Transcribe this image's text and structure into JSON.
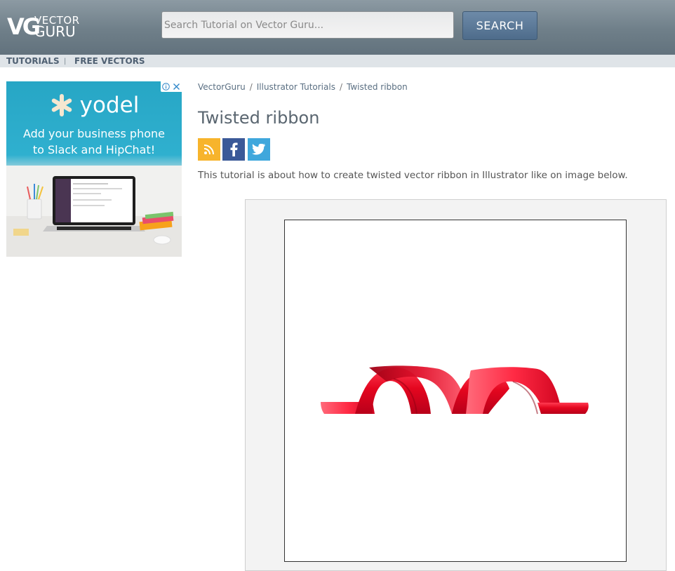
{
  "header": {
    "logo": {
      "mark": "VG",
      "top": "VECTOR",
      "bottom": "GURU"
    },
    "search": {
      "placeholder": "Search Tutorial on Vector Guru...",
      "button_label": "SEARCH"
    }
  },
  "nav": {
    "items": [
      {
        "label": "TUTORIALS"
      },
      {
        "label": "FREE VECTORS"
      }
    ],
    "separator": "|"
  },
  "ad": {
    "brand": "yodel",
    "headline_line1": "Add your business phone",
    "headline_line2": "to Slack and HipChat!",
    "info_icon": "info-icon",
    "close_icon": "close-icon"
  },
  "breadcrumb": {
    "items": [
      {
        "label": "VectorGuru"
      },
      {
        "label": "Illustrator Tutorials"
      },
      {
        "label": "Twisted ribbon"
      }
    ],
    "separator": "/"
  },
  "article": {
    "title": "Twisted ribbon",
    "intro": "This tutorial is about how to create twisted vector ribbon in Illustrator like on image below.",
    "share_icons": [
      "rss-icon",
      "facebook-icon",
      "twitter-icon"
    ]
  },
  "colors": {
    "header": "#6f7f89",
    "search_button": "#5a7898",
    "ad_background": "#2fb0cf",
    "ribbon": "#e30b2a",
    "rss": "#f7b42c",
    "facebook": "#3b5998",
    "twitter": "#3fa7dc"
  }
}
